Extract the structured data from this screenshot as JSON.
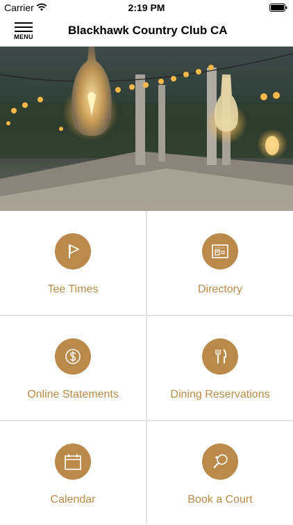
{
  "status_bar": {
    "carrier": "Carrier",
    "time": "2:19 PM"
  },
  "nav": {
    "menu_label": "MENU",
    "title": "Blackhawk Country Club CA"
  },
  "hero": {
    "image": "string-lights-patio"
  },
  "tiles": [
    {
      "label": "Tee Times",
      "icon": "flag-icon"
    },
    {
      "label": "Directory",
      "icon": "id-card-icon"
    },
    {
      "label": "Online Statements",
      "icon": "dollar-icon"
    },
    {
      "label": "Dining Reservations",
      "icon": "fork-knife-icon"
    },
    {
      "label": "Calendar",
      "icon": "calendar-icon"
    },
    {
      "label": "Book a Court",
      "icon": "paddle-icon"
    }
  ],
  "colors": {
    "accent": "#b98a4a",
    "background": "#ffffff",
    "divider": "#e4e4e4"
  }
}
